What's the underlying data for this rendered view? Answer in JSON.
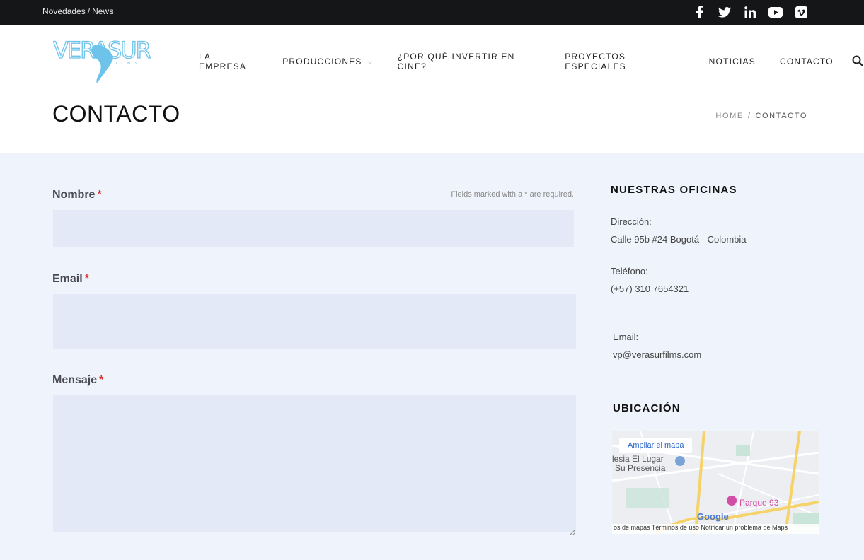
{
  "topbar": {
    "link1": "Novedades",
    "separator": "/",
    "link2": "News",
    "social": [
      "facebook-icon",
      "twitter-icon",
      "linkedin-icon",
      "youtube-icon",
      "vimeo-icon"
    ]
  },
  "nav": {
    "items": [
      {
        "label": "LA EMPRESA"
      },
      {
        "label": "PRODUCCIONES"
      },
      {
        "label": "¿POR QUÉ INVERTIR EN CINE?"
      },
      {
        "label": "PROYECTOS ESPECIALES"
      },
      {
        "label": "NOTICIAS"
      },
      {
        "label": "CONTACTO"
      }
    ]
  },
  "logo": {
    "text": "VERASUR",
    "sub": "FILMS",
    "color": "#6ec3ea"
  },
  "page": {
    "title": "CONTACTO",
    "breadcrumb": {
      "home": "HOME",
      "separator": "/",
      "current": "CONTACTO"
    }
  },
  "form": {
    "required_note": "Fields marked with a * are required.",
    "required_mark": "*",
    "name_label": "Nombre",
    "email_label": "Email",
    "message_label": "Mensaje"
  },
  "sidebar": {
    "offices_heading": "NUESTRAS OFICINAS",
    "address_label": "Dirección:",
    "address_value": "Calle 95b #24 Bogotá - Colombia",
    "phone_label": "Teléfono:",
    "phone_value": "(+57) 310 7654321",
    "email_label": "Email:",
    "email_value": "vp@verasurfilms.com",
    "location_heading": "UBICACIÓN"
  },
  "map": {
    "enlarge": "Ampliar el mapa",
    "place1": "lesia El Lugar",
    "place2": "Su Presencia",
    "park": "Parque 93",
    "google": "Google",
    "footer": "os de mapas   Términos de uso   Notificar un problema de Maps"
  },
  "colors": {
    "accent": "#d9342b",
    "field": "#e3e9f7",
    "topbar": "#151618"
  }
}
